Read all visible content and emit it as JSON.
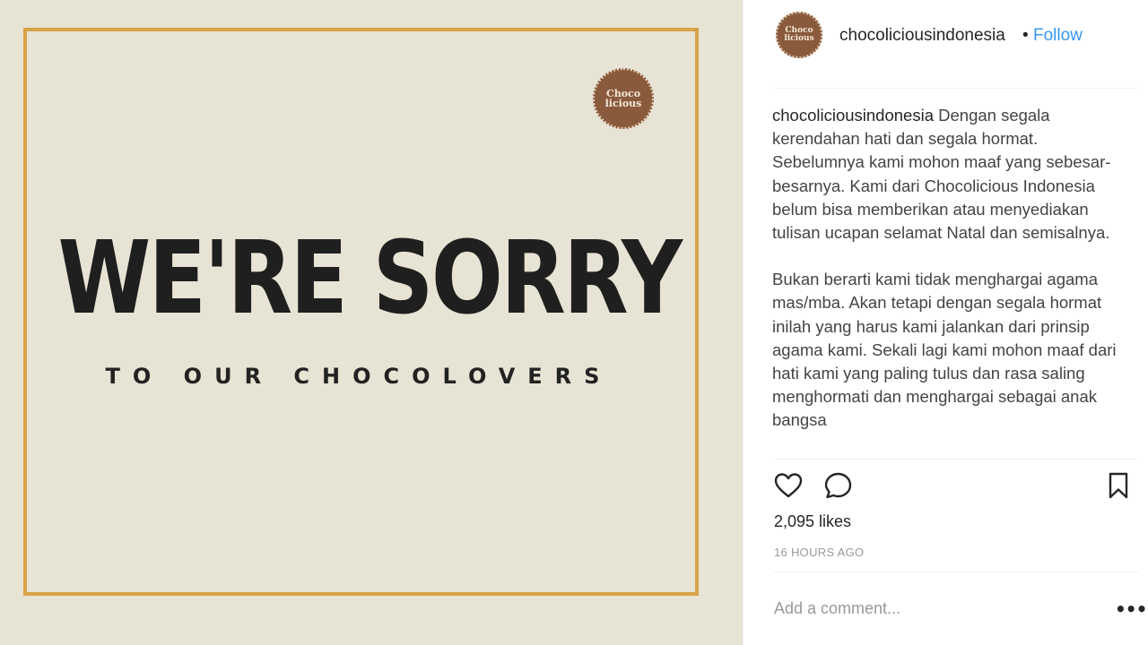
{
  "post": {
    "image": {
      "logo_line1": "Choco",
      "logo_line2": "licious",
      "headline": "WE'RE SORRY",
      "subline": "TO OUR CHOCOLOVERS",
      "background": "#e7e3d5",
      "frame_color": "#d8a347"
    },
    "header": {
      "avatar_line1": "Choco",
      "avatar_line2": "licious",
      "username": "chocoliciousindonesia",
      "separator": "•",
      "follow_label": "Follow"
    },
    "caption": {
      "username": "chocoliciousindonesia",
      "paragraph1": "Dengan segala kerendahan hati dan segala hormat. Sebelumnya kami mohon maaf yang sebesar-besarnya. Kami dari Chocolicious Indonesia belum bisa memberikan atau menyediakan tulisan ucapan selamat Natal dan semisalnya.",
      "paragraph2": "Bukan berarti kami tidak menghargai agama mas/mba. Akan tetapi dengan segala hormat inilah yang harus kami jalankan dari prinsip agama kami. Sekali lagi kami mohon maaf dari hati kami yang paling tulus dan rasa saling menghormati dan menghargai sebagai anak bangsa"
    },
    "actions": {
      "like_icon": "heart-icon",
      "comment_icon": "comment-bubble-icon",
      "save_icon": "bookmark-icon"
    },
    "likes": "2,095 likes",
    "timestamp": "16 HOURS AGO",
    "comment_placeholder": "Add a comment...",
    "more_label": "•••",
    "accent_color": "#3897f0"
  }
}
